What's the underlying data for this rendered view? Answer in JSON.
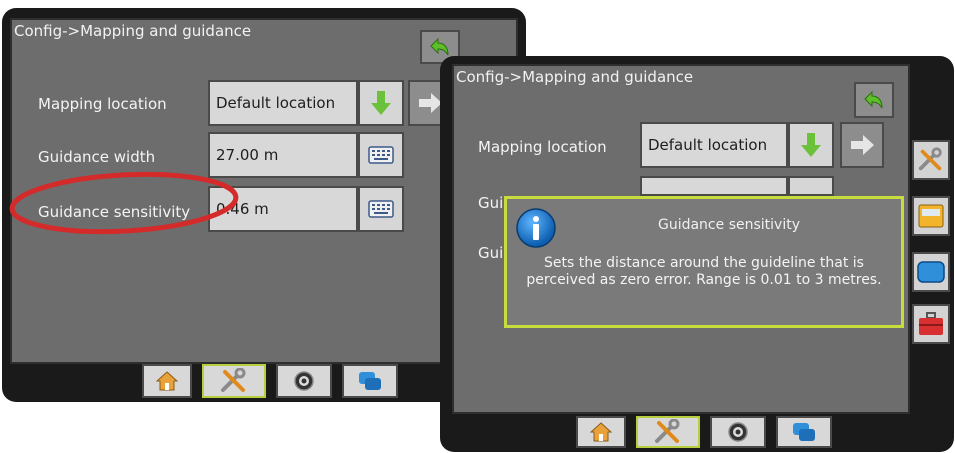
{
  "left_screen": {
    "title": "Config->Mapping and guidance",
    "rows": [
      {
        "label": "Mapping location",
        "value": "Default location"
      },
      {
        "label": "Guidance width",
        "value": "27.00 m"
      },
      {
        "label": "Guidance sensitivity",
        "value": "0.46 m"
      }
    ]
  },
  "right_screen": {
    "title": "Config->Mapping and guidance",
    "rows": [
      {
        "label": "Mapping location",
        "value": "Default location"
      },
      {
        "label": "Guic"
      },
      {
        "label": "Guic"
      }
    ],
    "popup": {
      "title": "Guidance sensitivity",
      "message": "Sets the distance around the guideline that is perceived as zero error. Range is 0.01 to 3 metres."
    }
  },
  "icons": {
    "back": "back-arrow-icon",
    "download": "green-down-arrow-icon",
    "next": "right-arrow-icon",
    "keyboard": "keyboard-icon",
    "home": "home-icon",
    "tools": "tools-icon",
    "gnss": "gnss-target-icon",
    "data": "data-icon",
    "info": "info-icon",
    "console": "console-icon",
    "display": "display-icon",
    "toolbox": "toolbox-icon"
  },
  "colors": {
    "highlight_circle": "#d42a2a",
    "active_border": "#b7cf3e",
    "popup_border": "#c9dc3d"
  }
}
